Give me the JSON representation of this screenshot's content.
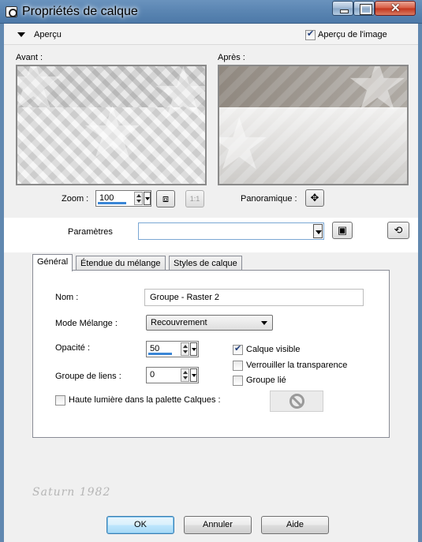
{
  "window": {
    "title": "Propriétés de calque"
  },
  "preview": {
    "section_label": "Aperçu",
    "image_preview_label": "Aperçu de l'image",
    "image_preview_checked": true,
    "before_label": "Avant :",
    "after_label": "Après :",
    "zoom_label": "Zoom :",
    "zoom_value": "100",
    "zoom_one_label": "1:1",
    "pan_label": "Panoramique :"
  },
  "parameters": {
    "label": "Paramètres",
    "value": ""
  },
  "tabs": [
    {
      "label": "Général",
      "active": true
    },
    {
      "label": "Étendue du mélange",
      "active": false
    },
    {
      "label": "Styles de calque",
      "active": false
    }
  ],
  "general": {
    "name_label": "Nom :",
    "name_value": "Groupe - Raster 2",
    "blend_label": "Mode Mélange :",
    "blend_value": "Recouvrement",
    "opacity_label": "Opacité :",
    "opacity_value": "50",
    "opacity_fraction": 0.5,
    "link_group_label": "Groupe de liens :",
    "link_group_value": "0",
    "visible_label": "Calque visible",
    "visible_checked": true,
    "lock_transparency_label": "Verrouiller la transparence",
    "lock_transparency_checked": false,
    "linked_group_label": "Groupe lié",
    "linked_group_checked": false,
    "highlight_label": "Haute lumière dans la palette Calques :",
    "highlight_checked": false
  },
  "watermark": "Saturn 1982",
  "buttons": {
    "ok": "OK",
    "cancel": "Annuler",
    "help": "Aide"
  },
  "colors": {
    "title_bar": "#5b86b3",
    "accent": "#3a86d6",
    "close_button": "#c2341c"
  }
}
